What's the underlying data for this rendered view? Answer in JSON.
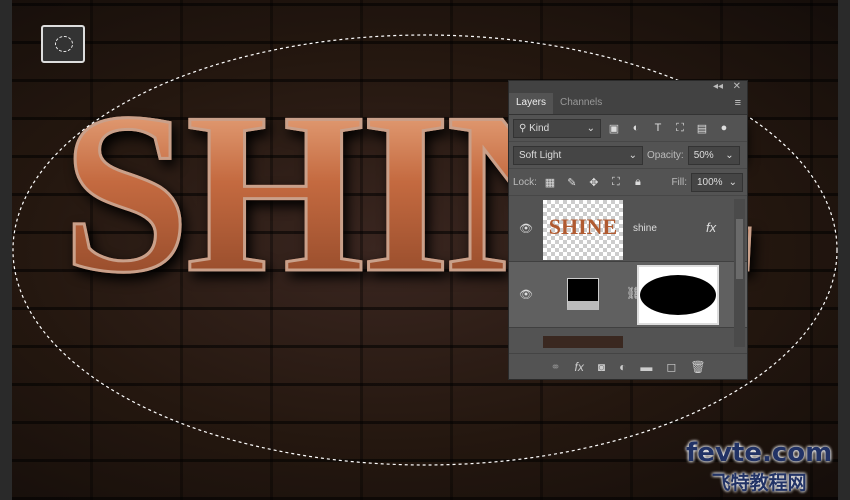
{
  "canvas": {
    "text": "SHINE"
  },
  "tool": {
    "icon": "elliptical-marquee-icon"
  },
  "panel": {
    "tabs": [
      "Layers",
      "Channels"
    ],
    "filter": {
      "label": "Kind"
    },
    "blend_mode": "Soft Light",
    "opacity_label": "Opacity:",
    "opacity": "50%",
    "lock_label": "Lock:",
    "fill_label": "Fill:",
    "fill": "100%",
    "layers": [
      {
        "name": "shine",
        "thumb_text": "SHINE",
        "fx": "fx",
        "visible": true
      },
      {
        "name": "",
        "type": "levels-adjustment-with-mask",
        "visible": true
      }
    ],
    "footer_icons": [
      "link-icon",
      "fx-icon",
      "mask-icon",
      "adjustment-icon",
      "folder-icon",
      "new-layer-icon",
      "trash-icon"
    ]
  },
  "watermark": {
    "line1": "fevte.com",
    "line2": "飞特教程网"
  }
}
